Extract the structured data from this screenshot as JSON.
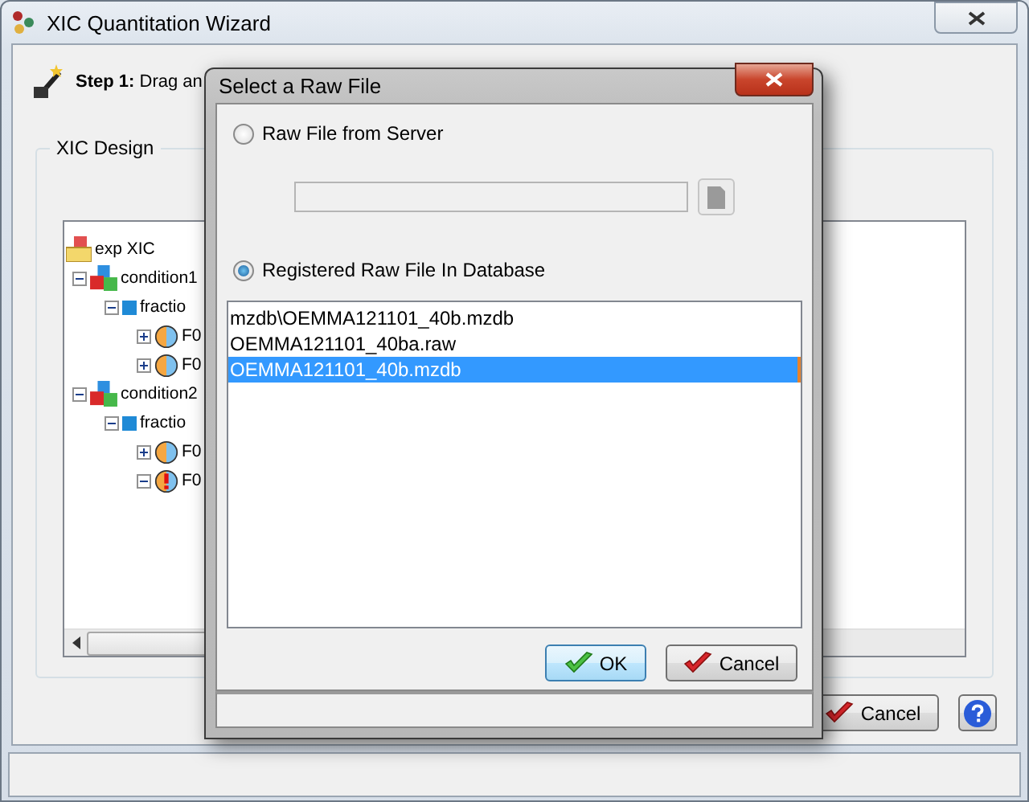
{
  "window": {
    "title": "XIC Quantitation Wizard"
  },
  "step": {
    "text": "**Step 1:** Drag an"
  },
  "group": {
    "title": "XIC Design"
  },
  "tree": [
    {
      "label": "exp XIC",
      "kind": "experiment",
      "children": [
        {
          "label": "condition1",
          "kind": "condition",
          "expanded": true,
          "children": [
            {
              "label": "fractio",
              "kind": "fraction",
              "expanded": true,
              "children": [
                {
                  "label": "F0",
                  "kind": "sample",
                  "expanded": false
                },
                {
                  "label": "F0",
                  "kind": "sample",
                  "expanded": false
                }
              ]
            }
          ]
        },
        {
          "label": "condition2",
          "kind": "condition",
          "expanded": true,
          "children": [
            {
              "label": "fractio",
              "kind": "fraction",
              "expanded": true,
              "children": [
                {
                  "label": "F0",
                  "kind": "sample",
                  "expanded": false
                },
                {
                  "label": "F0",
                  "kind": "sample_warning",
                  "expanded": true
                }
              ]
            }
          ]
        }
      ]
    }
  ],
  "footer_buttons": [
    {
      "label": "Cancel",
      "kind": "cancel"
    },
    {
      "kind": "help"
    }
  ],
  "dialog": {
    "title": "Select a Raw File",
    "options": [
      {
        "label": "Raw File from Server",
        "selected": false
      },
      {
        "label": "Registered Raw File In Database",
        "selected": true
      }
    ],
    "files": [
      {
        "name": "mzdb\\OEMMA121101_40b.mzdb",
        "selected": false
      },
      {
        "name": "OEMMA121101_40ba.raw",
        "selected": false
      },
      {
        "name": "OEMMA121101_40b.mzdb",
        "selected": true
      }
    ],
    "buttons": [
      {
        "label": "OK",
        "kind": "ok"
      },
      {
        "label": "Cancel",
        "kind": "cancel"
      }
    ]
  }
}
